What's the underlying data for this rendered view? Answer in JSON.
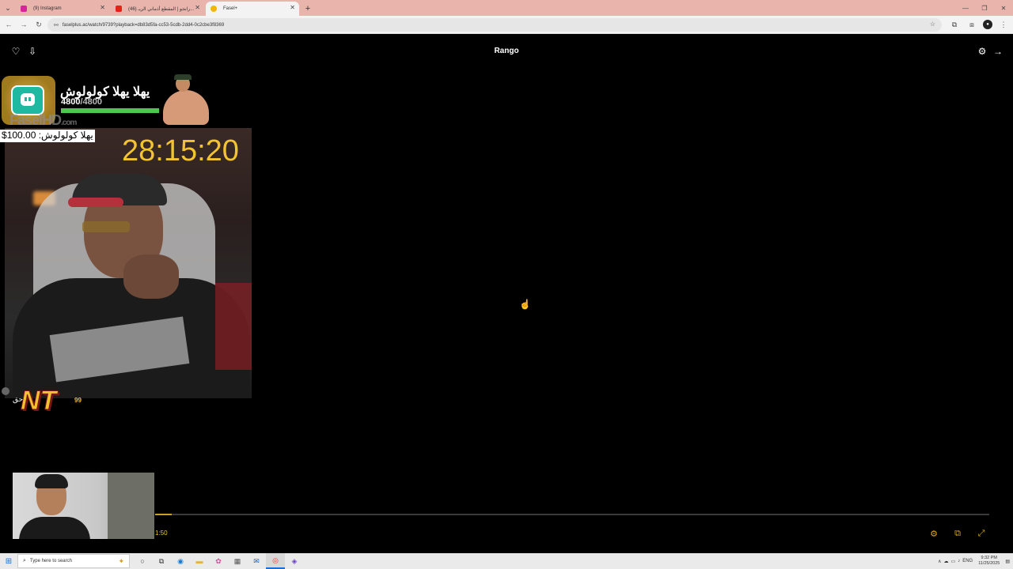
{
  "browser": {
    "tabs": [
      {
        "label": "(9) Instagram",
        "favicon_color": "#d6249f",
        "active": false
      },
      {
        "label": "(46) رانجو | المقطع أذماني الريـ...",
        "favicon_color": "#e62117",
        "active": false
      },
      {
        "label": "Fasel+",
        "favicon_color": "#f2b705",
        "active": true
      }
    ],
    "url": "faselplus.ac/watch/9739?playback=db83d5fa-cc53-5cdb-2dd4-0c2cbe3f8369"
  },
  "player": {
    "title": "Rango",
    "elapsed": "1:50",
    "progress_fraction": 0.02,
    "accent_color": "#d9a521"
  },
  "overlay": {
    "alert_name": "يهلا يهلا كولولوش",
    "count_current": "4800",
    "count_max": "/4800",
    "hp_fraction": 1.0,
    "watermark": "FaselHD",
    "watermark_suffix": ".com",
    "timer": "28:15:20",
    "donation": "يهلا كولولوش: 100.00$",
    "logo": "NT",
    "logo_number": "99",
    "side_text": "وحق"
  },
  "taskbar": {
    "search_placeholder": "Type here to search",
    "lang": "ENG",
    "time": "9:32 PM",
    "date": "11/25/2025"
  }
}
